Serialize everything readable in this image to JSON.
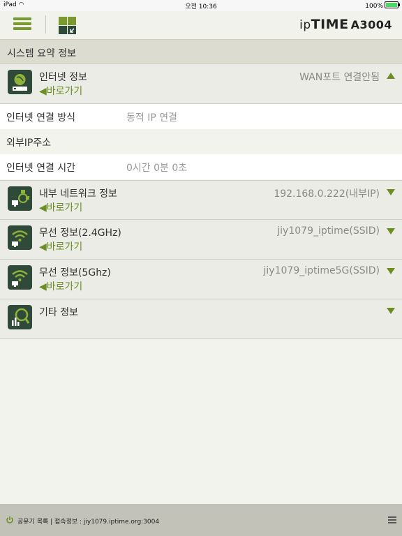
{
  "status_bar": {
    "device": "iPad",
    "time": "오전 10:36",
    "battery": "100%"
  },
  "header": {
    "brand_prefix": "ip",
    "brand_name": "TIME",
    "model": "A3004"
  },
  "section": {
    "title": "시스템 요약 정보"
  },
  "internet": {
    "title": "인터넷 정보",
    "goto": "◀바로가기",
    "value": "WAN포트 연결안됨",
    "details": [
      {
        "label": "인터넷 연결 방식",
        "value": "동적 IP 연결"
      },
      {
        "label": "외부IP주소",
        "value": ""
      },
      {
        "label": "인터넷 연결 시간",
        "value": "0시간 0분 0초"
      }
    ]
  },
  "internal_network": {
    "title": "내부 네트워크 정보",
    "goto": "◀바로가기",
    "value": "192.168.0.222(내부IP)"
  },
  "wireless_24": {
    "title": "무선 정보(2.4GHz)",
    "goto": "◀바로가기",
    "value": "jiy1079_iptime(SSID)"
  },
  "wireless_5": {
    "title": "무선 정보(5Ghz)",
    "goto": "◀바로가기",
    "value": "jiy1079_iptime5G(SSID)"
  },
  "other": {
    "title": "기타 정보"
  },
  "footer": {
    "text": "공유기 목록  |  접속정보 : jiy1079.iptime.org:3004"
  },
  "colors": {
    "accent": "#6b8e23",
    "icon_bg": "#2f4a39"
  }
}
